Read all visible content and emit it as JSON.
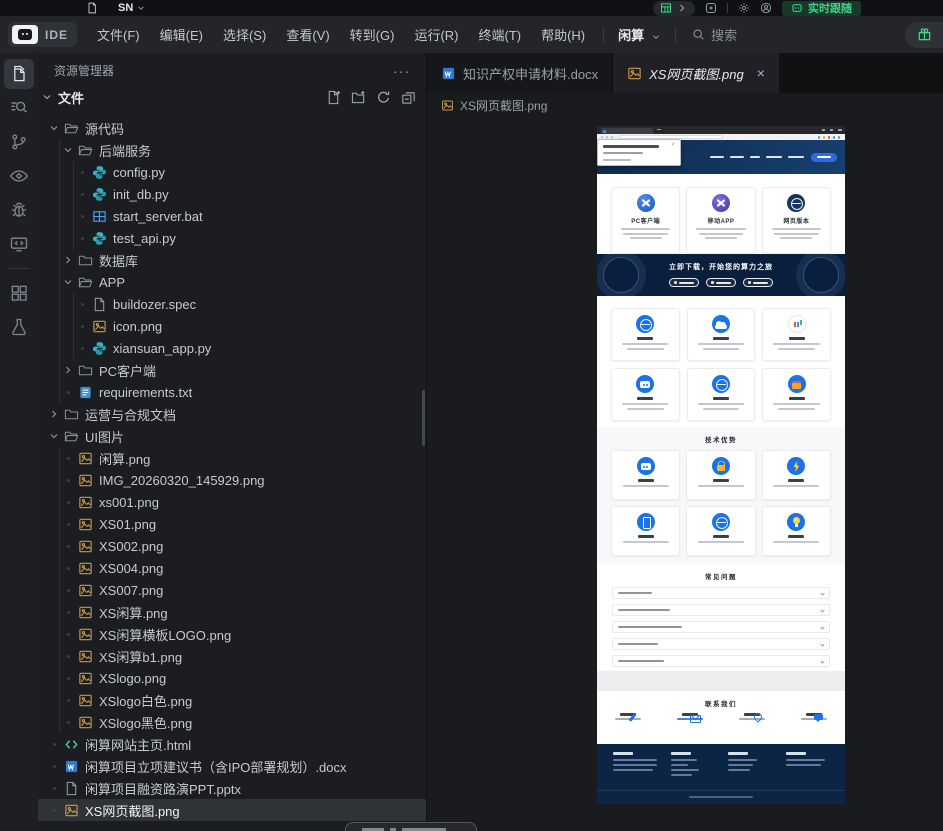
{
  "titlebar": {
    "project_name": "SN",
    "follow_badge": "实时跟随"
  },
  "menubar": {
    "logo_text": "IDE",
    "items": [
      "文件(F)",
      "编辑(E)",
      "选择(S)",
      "查看(V)",
      "转到(G)",
      "运行(R)",
      "终端(T)",
      "帮助(H)"
    ],
    "workspace_name": "闲算",
    "search_placeholder": "搜索"
  },
  "activitybar": {
    "icons": [
      {
        "name": "explorer-icon",
        "active": true
      },
      {
        "name": "search-icon",
        "active": false
      },
      {
        "name": "source-control-icon",
        "active": false
      },
      {
        "name": "eye-icon",
        "active": false
      },
      {
        "name": "debug-icon",
        "active": false
      },
      {
        "name": "remote-window-icon",
        "active": false
      },
      {
        "name": "extensions-icon",
        "active": false
      },
      {
        "name": "test-flask-icon",
        "active": false
      }
    ]
  },
  "sidebar": {
    "title": "资源管理器",
    "section_label": "文件",
    "actions": [
      "new-file-icon",
      "new-folder-icon",
      "refresh-icon",
      "collapse-all-icon"
    ],
    "tree": [
      {
        "depth": 0,
        "icon": "folder-open",
        "label": "源代码",
        "chevron": "open"
      },
      {
        "depth": 1,
        "icon": "folder-open",
        "label": "后端服务",
        "chevron": "open"
      },
      {
        "depth": 2,
        "icon": "python",
        "label": "config.py"
      },
      {
        "depth": 2,
        "icon": "python",
        "label": "init_db.py"
      },
      {
        "depth": 2,
        "icon": "bat",
        "label": "start_server.bat"
      },
      {
        "depth": 2,
        "icon": "python",
        "label": "test_api.py"
      },
      {
        "depth": 1,
        "icon": "folder",
        "label": "数据库",
        "chevron": "closed"
      },
      {
        "depth": 1,
        "icon": "folder-open",
        "label": "APP",
        "chevron": "open"
      },
      {
        "depth": 2,
        "icon": "file",
        "label": "buildozer.spec"
      },
      {
        "depth": 2,
        "icon": "image",
        "label": "icon.png"
      },
      {
        "depth": 2,
        "icon": "python",
        "label": "xiansuan_app.py"
      },
      {
        "depth": 1,
        "icon": "folder",
        "label": "PC客户端",
        "chevron": "closed"
      },
      {
        "depth": 1,
        "icon": "textfile",
        "label": "requirements.txt"
      },
      {
        "depth": 0,
        "icon": "folder",
        "label": "运营与合规文档",
        "chevron": "closed"
      },
      {
        "depth": 0,
        "icon": "folder-open",
        "label": "UI图片",
        "chevron": "open"
      },
      {
        "depth": 1,
        "icon": "image",
        "label": "闲算.png"
      },
      {
        "depth": 1,
        "icon": "image",
        "label": "IMG_20260320_145929.png"
      },
      {
        "depth": 1,
        "icon": "image",
        "label": "xs001.png"
      },
      {
        "depth": 1,
        "icon": "image",
        "label": "XS01.png"
      },
      {
        "depth": 1,
        "icon": "image",
        "label": "XS002.png"
      },
      {
        "depth": 1,
        "icon": "image",
        "label": "XS004.png"
      },
      {
        "depth": 1,
        "icon": "image",
        "label": "XS007.png"
      },
      {
        "depth": 1,
        "icon": "image",
        "label": "XS闲算.png"
      },
      {
        "depth": 1,
        "icon": "image",
        "label": "XS闲算横板LOGO.png"
      },
      {
        "depth": 1,
        "icon": "image",
        "label": "XS闲算b1.png"
      },
      {
        "depth": 1,
        "icon": "image",
        "label": "XSlogo.png"
      },
      {
        "depth": 1,
        "icon": "image",
        "label": "XSlogo白色.png"
      },
      {
        "depth": 1,
        "icon": "image",
        "label": "XSlogo黑色.png"
      },
      {
        "depth": 0,
        "icon": "html",
        "label": "闲算网站主页.html"
      },
      {
        "depth": 0,
        "icon": "word",
        "label": "闲算项目立项建议书（含IPO部署规划）.docx"
      },
      {
        "depth": 0,
        "icon": "file",
        "label": "闲算项目融资路演PPT.pptx"
      },
      {
        "depth": 0,
        "icon": "image",
        "label": "XS网页截图.png",
        "selected": true
      }
    ]
  },
  "editor": {
    "tabs": [
      {
        "label": "知识产权申请材料.docx",
        "icon": "word",
        "active": false
      },
      {
        "label": "XS网页截图.png",
        "icon": "image",
        "active": true
      }
    ],
    "breadcrumb": "XS网页截图.png"
  },
  "preview_page": {
    "download_cards": [
      {
        "icon": "x-logo-icon",
        "title": "PC客户端"
      },
      {
        "icon": "x-logo-icon",
        "title": "移动APP"
      },
      {
        "icon": "web-version-icon",
        "title": "网页版本"
      }
    ],
    "banner_title": "立即下载，开始您的算力之旅",
    "banner_button_count": 3,
    "feature_icons": [
      "network-globe-icon",
      "cloud-icon",
      "bar-chart-icon",
      "robot-icon",
      "earth-icon",
      "gift-icon"
    ],
    "section_tech": "技术优势",
    "tech_icons": [
      "robot-icon",
      "lock-icon",
      "bolt-icon",
      "phone-icon-w",
      "globe-icon",
      "bulb-icon"
    ],
    "section_faq": "常见问题",
    "faq_row_count": 5,
    "section_contact": "联系我们",
    "contact_icons": [
      "phone-icon",
      "mail-icon",
      "location-icon",
      "chat-icon"
    ],
    "footer_column_count": 4
  },
  "colors": {
    "accent_blue": "#2f6bd9",
    "site_navy": "#0d2545",
    "badge_green": "#3fd18a",
    "python_teal": "#36b3c9",
    "image_amber": "#c79b4e"
  }
}
